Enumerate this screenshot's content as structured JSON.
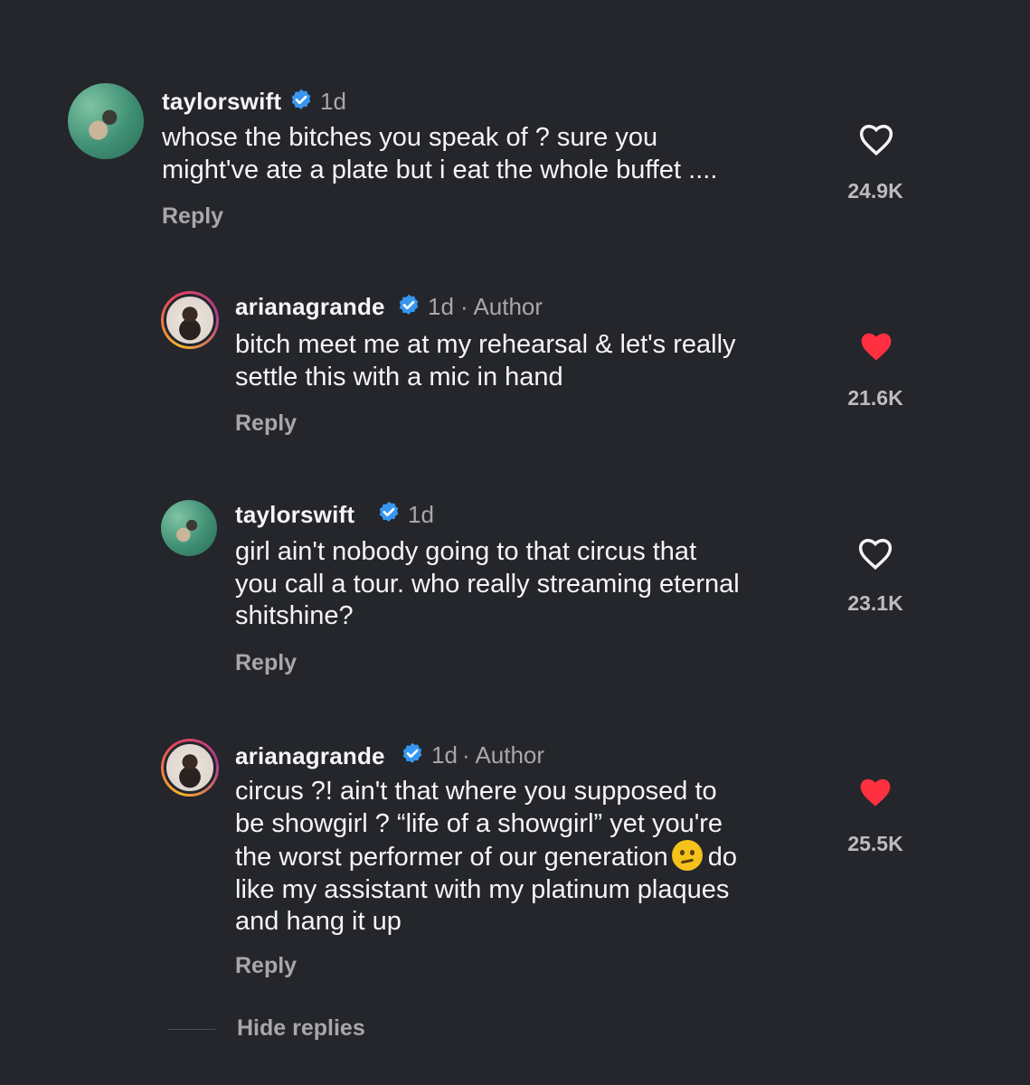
{
  "comments": [
    {
      "username": "taylorswift",
      "verified": true,
      "time": "1d",
      "author_tag": "",
      "lines": [
        "whose the bitches you speak of ? sure you",
        "might've ate a plate but i eat the whole buffet ...."
      ],
      "reply_label": "Reply",
      "liked": false,
      "likes": "24.9K"
    },
    {
      "username": "arianagrande",
      "verified": true,
      "time": "1d",
      "author_tag": "· Author",
      "lines": [
        "bitch meet me at my rehearsal & let's really",
        "settle this with a mic in hand"
      ],
      "reply_label": "Reply",
      "liked": true,
      "likes": "21.6K"
    },
    {
      "username": "taylorswift",
      "verified": true,
      "time": "1d",
      "author_tag": "",
      "lines": [
        "girl ain't nobody going to that circus that",
        "you call a tour. who really streaming eternal",
        "shitshine?"
      ],
      "reply_label": "Reply",
      "liked": false,
      "likes": "23.1K"
    },
    {
      "username": "arianagrande",
      "verified": true,
      "time": "1d",
      "author_tag": "· Author",
      "lines": [
        "circus ?! ain't that where you supposed to",
        "be showgirl ? “life of a showgirl” yet you're",
        "the worst performer of our generation",
        "like my assistant with my platinum plaques",
        "and hang it up"
      ],
      "line3_suffix": "do",
      "emoji": "confused-face-emoji",
      "reply_label": "Reply",
      "liked": true,
      "likes": "25.5K"
    }
  ],
  "hide_replies_label": "Hide replies",
  "colors": {
    "background": "#24262b",
    "verified_blue": "#3797f0",
    "liked_red": "#ff3040",
    "secondary_text": "#a8a8a8"
  },
  "icons": [
    "verified-badge-icon",
    "heart-outline-icon",
    "heart-filled-icon",
    "avatar"
  ]
}
